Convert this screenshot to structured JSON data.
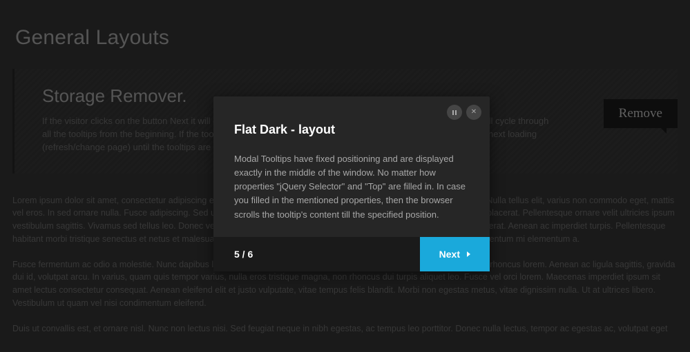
{
  "page": {
    "title": "General Layouts"
  },
  "callout": {
    "title": "Storage Remover.",
    "body": "If the visitor clicks on the button Next it will display the next tooltip and if the visitor clicks on the same button it will cycle through all the tooltips from the beginning. If the tooltip browser is closed then the tour will appear and will emerge at the next loading (refresh/change page) until the tooltips are marked seen or the tooltip browser stores the step where it stopped.",
    "remove_label": "Remove"
  },
  "paragraphs": {
    "p1": "Lorem ipsum dolor sit amet, consectetur adipiscing elit. Curabitur bibendum ornare dolor, quis ullamcorper ligula sodales at. Nulla tellus elit, varius non commodo eget, mattis vel eros. In sed ornare nulla. Fusce adipiscing. Sed ut mauris et nibh placerat sodales eu ut lectus. In lobortis sed dolor quis placerat. Pellentesque ornare velit ultricies ipsum vestibulum sagittis. Vivamus sed tellus leo. Donec vel arcu sollicitudin, in pellentesque turpis sagittis. Aliquam vel fermentum erat. Aenean ac imperdiet turpis. Pellentesque habitant morbi tristique senectus et netus et malesuada fames ac turpis egestas. Suspendisse mattis pulvinar erat, ut condimentum mi elementum a.",
    "p2": "Fusce fermentum ac odio a molestie. Nunc dapibus lacinia placerat. In nec mauris sit amet orci rhoncus ornare. Proin ornare rhoncus lorem. Aenean ac ligula sagittis, gravida dui id, volutpat arcu. In varius, quam quis tempor varius, nulla eros tristique magna, non rhoncus dui turpis aliquet leo. Fusce vel orci lorem. Maecenas imperdiet ipsum sit amet lectus consectetur consequat. Aenean eleifend elit et justo vulputate, vitae tempus felis blandit. Morbi non egestas metus, vitae dignissim nulla. Ut at ultrices libero. Vestibulum ut quam vel nisi condimentum eleifend.",
    "p3": "Duis ut convallis est, et ornare nisl. Nunc non lectus nisi. Sed feugiat neque in nibh egestas, ac tempus leo porttitor. Donec nulla lectus, tempor ac egestas ac, volutpat eget"
  },
  "modal": {
    "title": "Flat Dark - layout",
    "body": "Modal Tooltips have fixed positioning and are displayed exactly in the middle of the window. No matter how properties \"jQuery Selector\" and \"Top\" are filled in. In case you filled in the mentioned properties, then the browser scrolls the tooltip's content till the specified position.",
    "step": "5 / 6",
    "next_label": "Next"
  }
}
